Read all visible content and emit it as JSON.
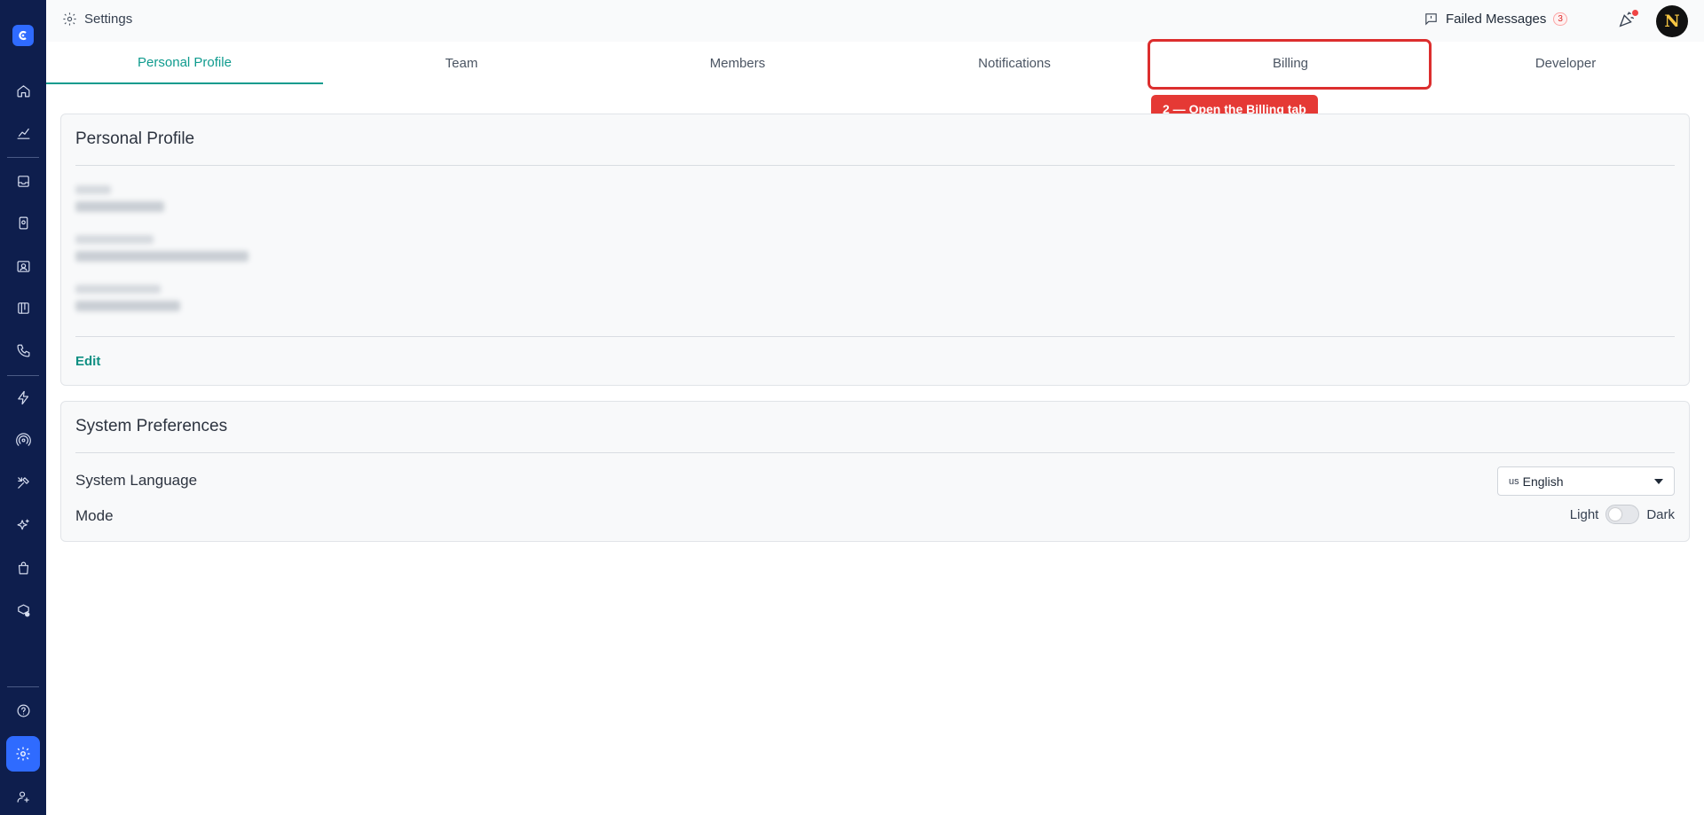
{
  "header": {
    "breadcrumb": "Settings",
    "failed_messages_label": "Failed Messages",
    "failed_messages_count": "3",
    "avatar_initial": "N"
  },
  "tabs": [
    {
      "label": "Personal Profile",
      "active": true
    },
    {
      "label": "Team"
    },
    {
      "label": "Members"
    },
    {
      "label": "Notifications"
    },
    {
      "label": "Billing"
    },
    {
      "label": "Developer"
    }
  ],
  "annotation": {
    "callout_text": "2 — Open the Billing tab",
    "color": "#e53935"
  },
  "personal_profile": {
    "title": "Personal Profile",
    "edit_label": "Edit"
  },
  "system_preferences": {
    "title": "System Preferences",
    "language_label": "System Language",
    "language_flag": "us",
    "language_value": "English",
    "mode_label": "Mode",
    "mode_light": "Light",
    "mode_dark": "Dark",
    "mode_dark_enabled": false
  },
  "sidebar": {
    "items": [
      "home-icon",
      "analytics-icon",
      "inbox-icon",
      "contacts-icon",
      "contact-card-icon",
      "board-icon",
      "phone-icon",
      "automation-icon",
      "broadcast-icon",
      "tools-icon",
      "ai-icon",
      "shop-icon",
      "integrations-icon",
      "help-icon",
      "settings-icon",
      "user-settings-icon"
    ]
  },
  "colors": {
    "sidebar": "#0e1e4d",
    "accent": "#0f9b8e",
    "primary": "#2f6bff"
  }
}
